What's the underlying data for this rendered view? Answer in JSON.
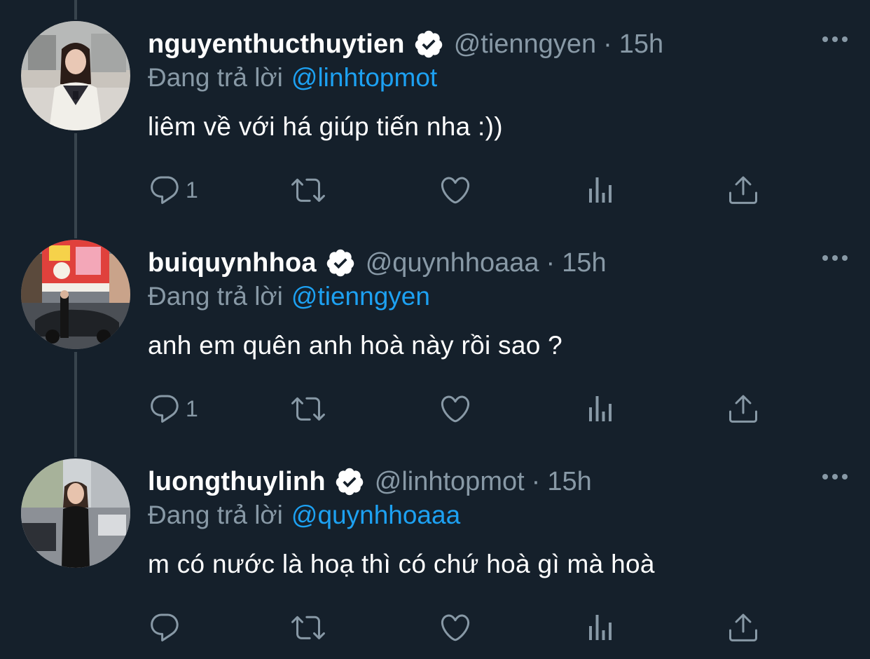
{
  "tweets": [
    {
      "name": "nguyenthucthuytien",
      "handle": "@tienngyen",
      "separator": "·",
      "time": "15h",
      "replying_label": "Đang trả lời",
      "replying_to": "@linhtopmot",
      "text": "liêm về với há giúp tiến nha :))",
      "reply_count": "1"
    },
    {
      "name": "buiquynhhoa",
      "handle": "@quynhhoaaa",
      "separator": "·",
      "time": "15h",
      "replying_label": "Đang trả lời",
      "replying_to": "@tienngyen",
      "text": "anh em quên anh hoà này rồi sao ?",
      "reply_count": "1"
    },
    {
      "name": "luongthuylinh",
      "handle": "@linhtopmot",
      "separator": "·",
      "time": "15h",
      "replying_label": "Đang trả lời",
      "replying_to": "@quynhhoaaa",
      "text": "m có nước là hoạ thì có chứ hoà gì mà hoà",
      "reply_count": ""
    }
  ],
  "icons": {
    "reply": "reply-icon",
    "retweet": "retweet-icon",
    "like": "like-icon",
    "analytics": "analytics-icon",
    "share": "share-icon",
    "more": "more-icon",
    "verified": "verified-badge-icon"
  },
  "colors": {
    "background": "#15202b",
    "secondary_text": "#8899a6",
    "link": "#1da1f2",
    "thread_line": "#38444d"
  }
}
